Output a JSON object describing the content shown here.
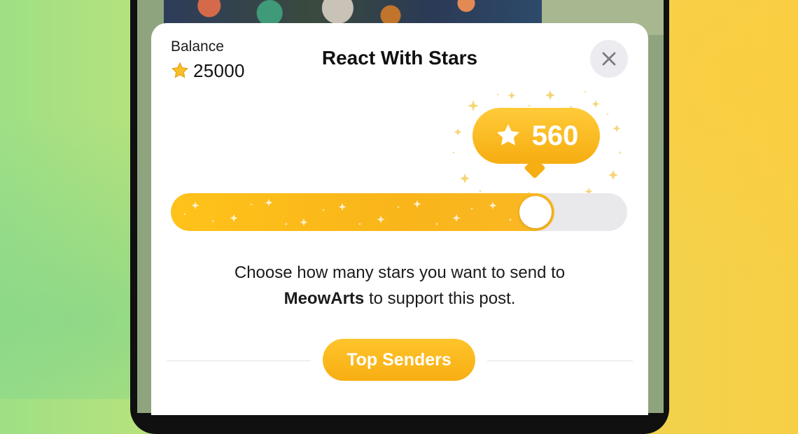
{
  "sheet": {
    "title": "React With Stars",
    "close_icon": "close-icon"
  },
  "balance": {
    "label": "Balance",
    "value": "25000",
    "icon": "star-icon"
  },
  "selector": {
    "amount": "560",
    "icon": "star-icon",
    "slider_fraction": 0.84
  },
  "description": {
    "prefix": "Choose how many stars you want to send to",
    "channel": "MeowArts",
    "suffix": "to support this post."
  },
  "top_senders": {
    "label": "Top Senders"
  },
  "colors": {
    "accent": "#f7ae12",
    "accent_light": "#ffcb3a",
    "track": "#e9e9ec",
    "close_bg": "#ececf0"
  }
}
